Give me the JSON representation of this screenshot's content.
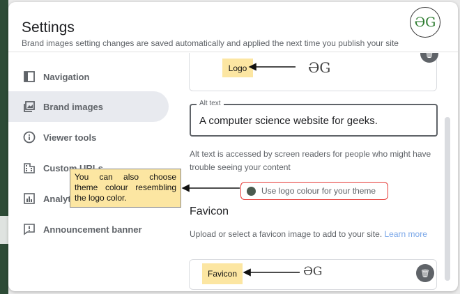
{
  "header": {
    "title": "Settings",
    "subtitle": "Brand images setting changes are saved automatically and applied the next time you publish your site",
    "avatar_text": "ƏG"
  },
  "sidebar": {
    "items": [
      {
        "label": "Navigation",
        "icon": "navigation-icon",
        "active": false
      },
      {
        "label": "Brand images",
        "icon": "image-icon",
        "active": true
      },
      {
        "label": "Viewer tools",
        "icon": "info-icon",
        "active": false
      },
      {
        "label": "Custom URLs",
        "icon": "building-icon",
        "active": false
      },
      {
        "label": "Analyti",
        "icon": "analytics-icon",
        "active": false
      },
      {
        "label": "Announcement banner",
        "icon": "announcement-icon",
        "active": false
      }
    ]
  },
  "content": {
    "logo_callout": "Logo",
    "logo_mark": "ƏG",
    "alt_label": "Alt text",
    "alt_value": "A computer science website for geeks.",
    "alt_help": "Alt text is accessed by screen readers for people who might have trouble seeing your content",
    "logo_colour_label": "Use logo colour for your theme",
    "favicon_heading": "Favicon",
    "favicon_help": "Upload or select a favicon image to add to your site.",
    "favicon_learn_more": "Learn more",
    "favicon_callout": "Favicon",
    "favicon_mark": "ƏG"
  },
  "annotation": {
    "note": "You can also choose theme colour resembling the logo color."
  },
  "colors": {
    "callout": "#fce6a2",
    "highlight_border": "#e53935",
    "sidebar_active": "#e8eaef",
    "brand_green": "#2d4b36"
  }
}
